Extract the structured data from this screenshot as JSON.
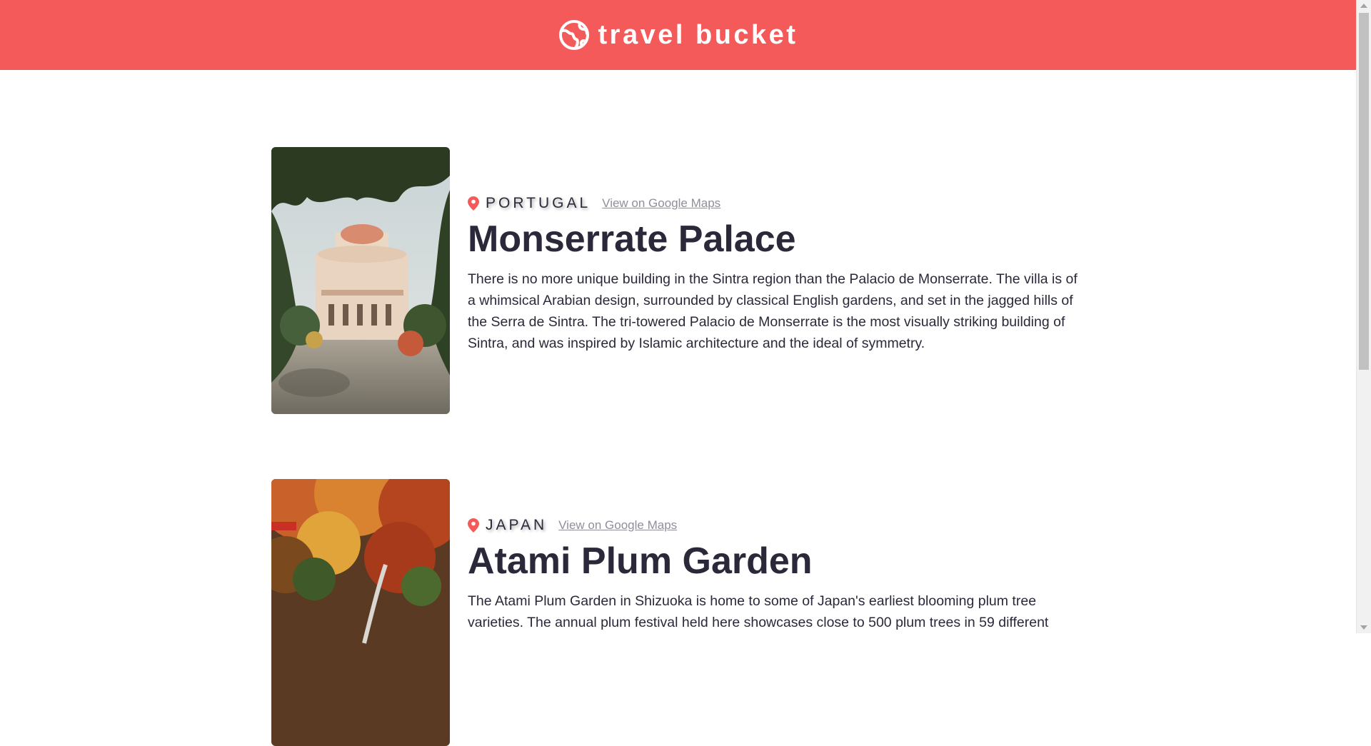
{
  "header": {
    "brand": "travel bucket",
    "icon": "globe-icon",
    "background_color": "#f55a5a"
  },
  "entries": [
    {
      "country": "PORTUGAL",
      "maps_link": "View on Google Maps",
      "title": "Monserrate Palace",
      "description": "There is no more unique building in the Sintra region than the Palacio de Monserrate. The villa is of a whimsical Arabian design, surrounded by classical English gardens, and set in the jagged hills of the Serra de Sintra. The tri-towered Palacio de Monserrate is the most visually striking building of Sintra, and was inspired by Islamic architecture and the ideal of symmetry.",
      "pin_icon": "location-pin-icon"
    },
    {
      "country": "JAPAN",
      "maps_link": "View on Google Maps",
      "title": "Atami Plum Garden",
      "description": "The Atami Plum Garden in Shizuoka is home to some of Japan's earliest blooming plum tree varieties. The annual plum festival held here showcases close to 500 plum trees in 59 different",
      "pin_icon": "location-pin-icon"
    }
  ],
  "colors": {
    "accent": "#f55a5a",
    "heading": "#2b283a",
    "link": "#918e9b"
  }
}
